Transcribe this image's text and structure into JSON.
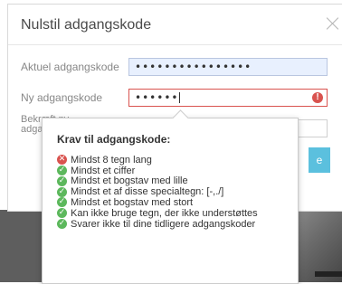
{
  "dialog": {
    "title": "Nulstil adgangskode",
    "fields": {
      "current": {
        "label": "Aktuel adgangskode",
        "value": "••••••••••••••••"
      },
      "new": {
        "label": "Ny adgangskode",
        "value": "••••••"
      },
      "confirm": {
        "label": "Bekræft ny adgangskode",
        "value": ""
      }
    },
    "error_icon": "!",
    "submit_label": "e"
  },
  "popover": {
    "title": "Krav til adgangskode:",
    "requirements": [
      {
        "text": "Mindst 8 tegn lang",
        "status": "fail",
        "icon": "x-circle-icon"
      },
      {
        "text": "Mindst et ciffer",
        "status": "ok",
        "icon": "check-circle-icon"
      },
      {
        "text": "Mindst et bogstav med lille",
        "status": "ok",
        "icon": "check-circle-icon"
      },
      {
        "text": "Mindst et af disse specialtegn: [-,./]",
        "status": "ok",
        "icon": "check-circle-icon"
      },
      {
        "text": "Mindst et bogstav med stort",
        "status": "ok",
        "icon": "check-circle-icon"
      },
      {
        "text": "Kan ikke bruge tegn, der ikke understøttes",
        "status": "ok",
        "icon": "check-circle-icon"
      },
      {
        "text": "Svarer ikke til dine tidligere adgangskoder",
        "status": "ok",
        "icon": "check-circle-icon"
      }
    ]
  },
  "colors": {
    "ok": "#5cb85c",
    "fail": "#d9534f",
    "accent": "#5bc0de"
  }
}
